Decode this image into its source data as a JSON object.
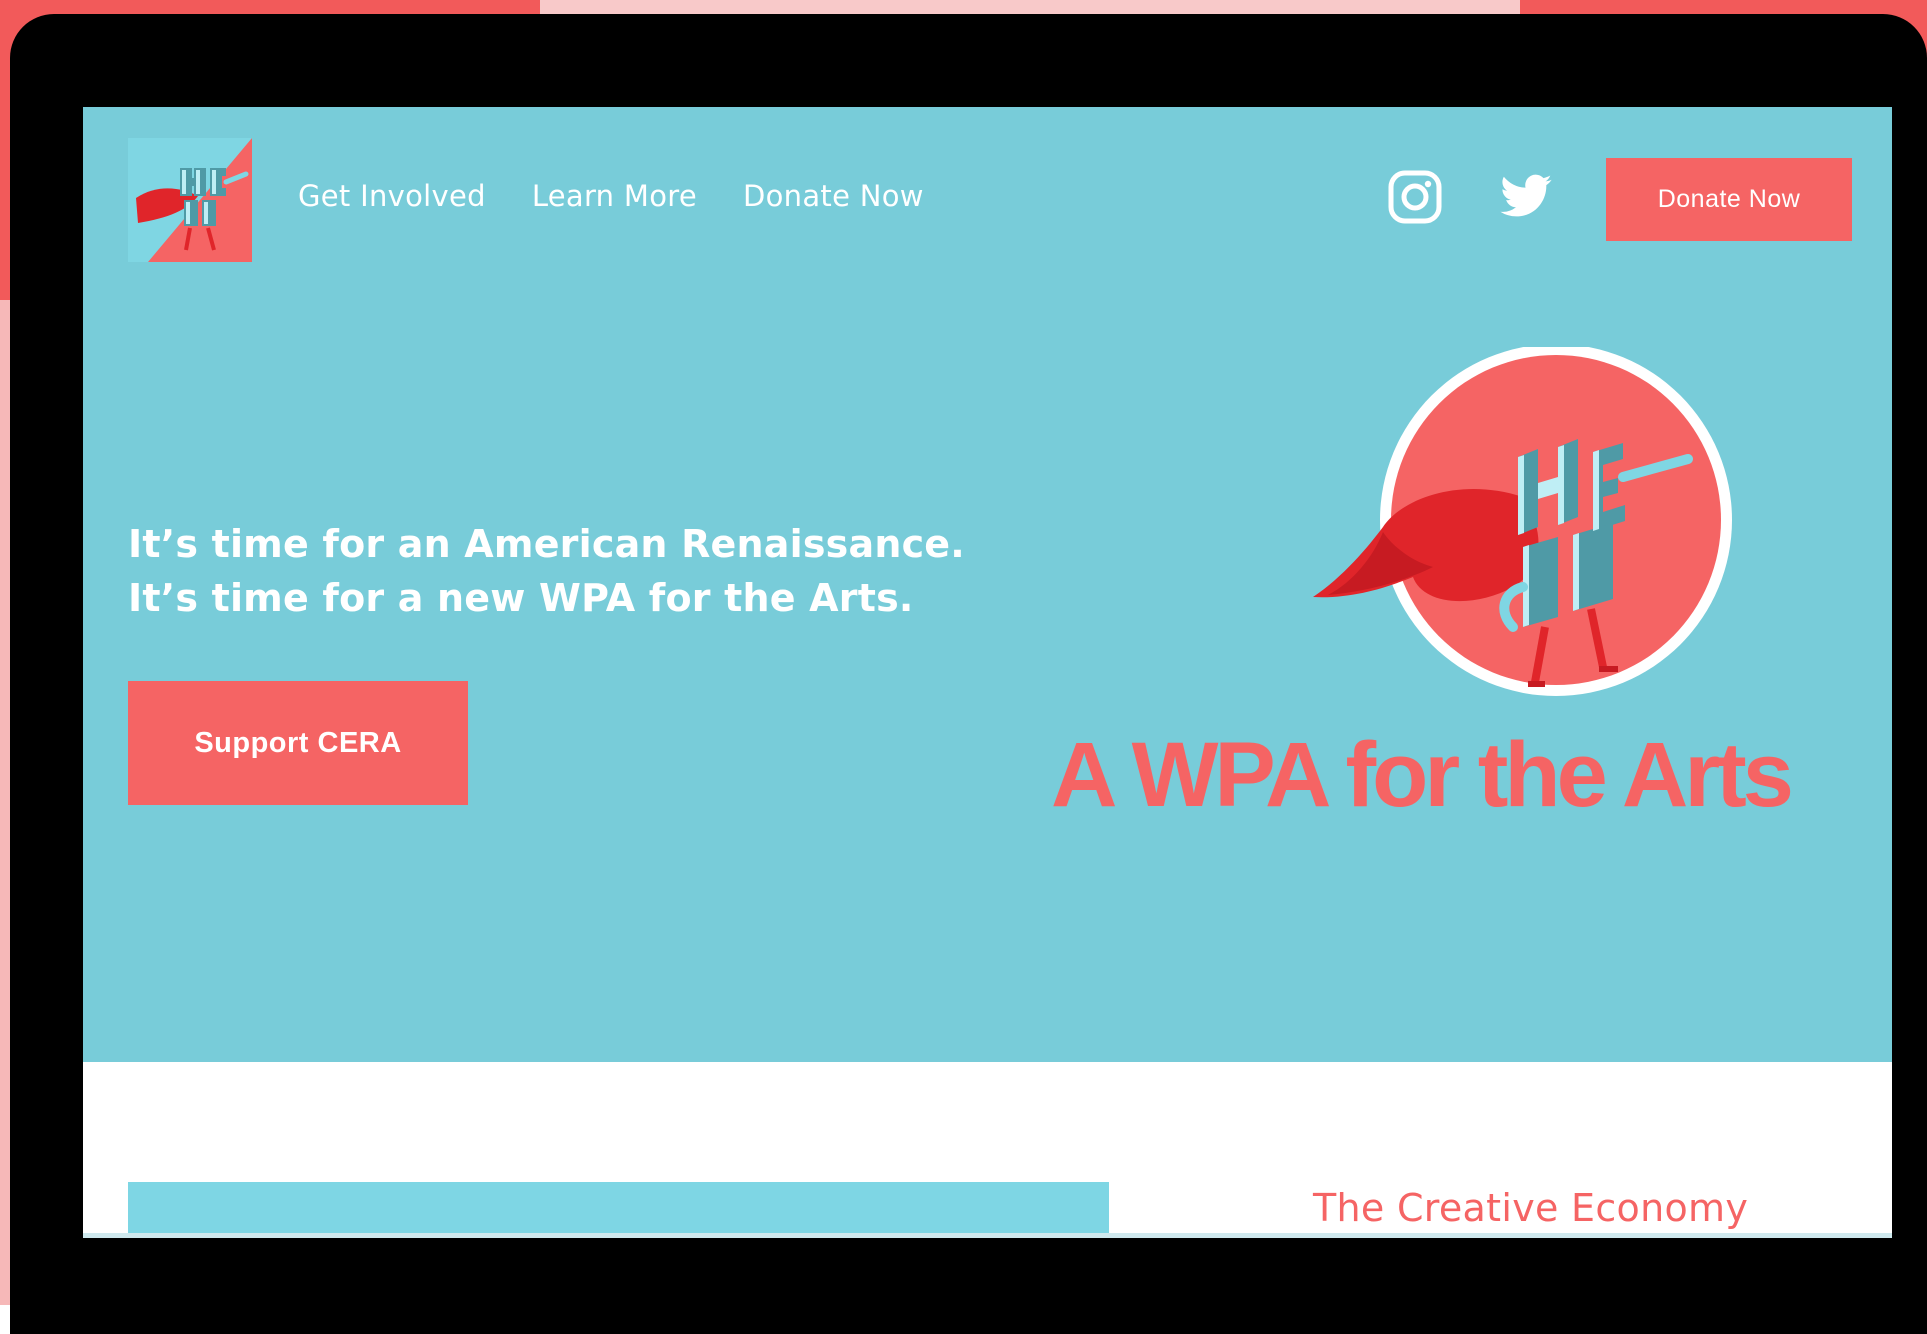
{
  "nav": {
    "items": [
      {
        "label": "Get Involved"
      },
      {
        "label": "Learn More"
      },
      {
        "label": "Donate Now"
      }
    ],
    "donate_button": "Donate Now",
    "social": [
      {
        "icon": "instagram-icon"
      },
      {
        "icon": "twitter-icon"
      }
    ]
  },
  "hero": {
    "headline_line1": "It’s time for an American Renaissance.",
    "headline_line2": "It’s time for a new WPA for the Arts.",
    "cta_label": "Support CERA",
    "tagline": "A WPA for the Arts"
  },
  "section": {
    "title": "The Creative Economy"
  },
  "colors": {
    "teal": "#78ccd9",
    "coral": "#f56464",
    "red": "#e0252a",
    "frame": "#000000"
  }
}
